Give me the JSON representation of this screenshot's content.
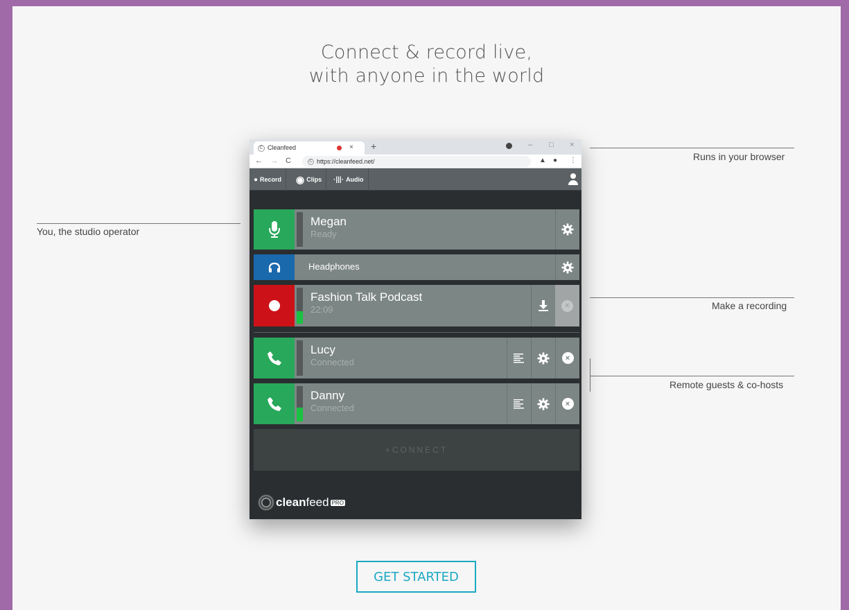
{
  "headline": {
    "line1": "Connect & record live,",
    "line2": "with anyone in the world"
  },
  "annotations": {
    "browser": "Runs in your browser",
    "operator": "You, the studio operator",
    "recording": "Make a recording",
    "guests": "Remote guests & co-hosts"
  },
  "browser": {
    "tab_title": "Cleanfeed",
    "tab_favicon": "C",
    "new_tab": "+",
    "tab_close": "×",
    "url": "https://cleanfeed.net/",
    "minimize": "–",
    "maximize": "□",
    "close": "×",
    "back": "←",
    "forward": "→",
    "reload": "C",
    "menu": "⋮"
  },
  "toolbar": {
    "record_label": "Record",
    "clips_label": "Clips",
    "audio_label": "Audio"
  },
  "rows": {
    "megan": {
      "name": "Megan",
      "status": "Ready"
    },
    "headphones": {
      "label": "Headphones"
    },
    "recording": {
      "name": "Fashion Talk Podcast",
      "time": "22:09"
    },
    "lucy": {
      "name": "Lucy",
      "status": "Connected"
    },
    "danny": {
      "name": "Danny",
      "status": "Connected"
    }
  },
  "connect_label": "+CONNECT",
  "brand": {
    "name_bold": "clean",
    "name_rest": "feed",
    "badge": "PRO"
  },
  "cta_label": "GET STARTED",
  "colors": {
    "background": "#a06aa8",
    "mic_green": "#28a85a",
    "headphones_blue": "#1a69ad",
    "record_red": "#cc1218",
    "cta": "#1aa8c2",
    "meter_green": "#19c341"
  },
  "icons": [
    "microphone-icon",
    "headphones-icon",
    "record-dot-icon",
    "phone-icon",
    "gear-icon",
    "download-icon",
    "close-circle-icon",
    "list-icon",
    "user-icon"
  ]
}
